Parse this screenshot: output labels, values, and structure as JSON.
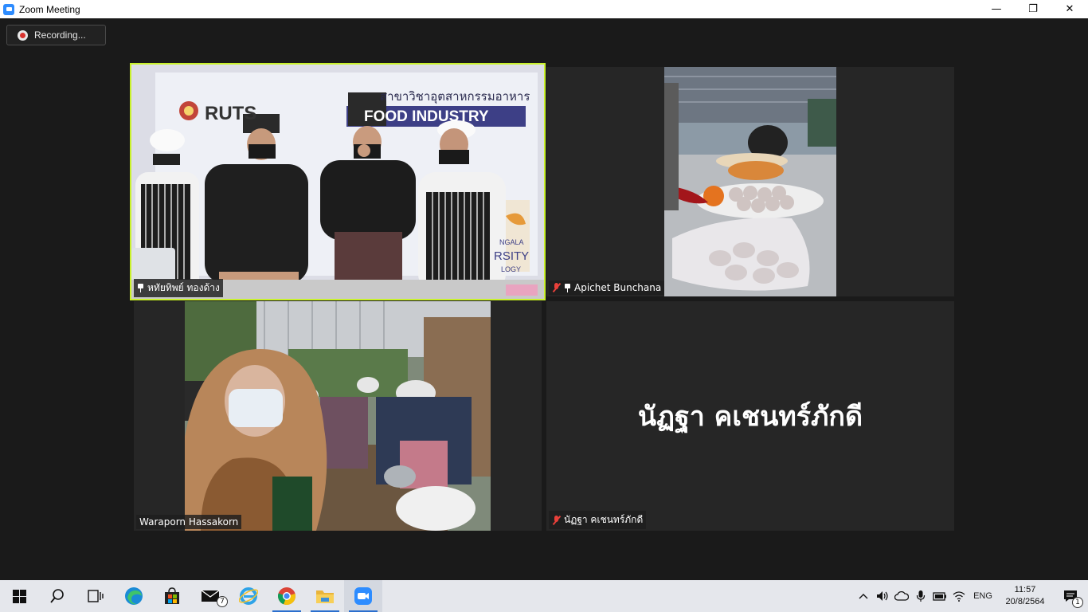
{
  "window": {
    "title": "Zoom Meeting",
    "minimize": "—",
    "restore": "❐",
    "close": "✕"
  },
  "recording": {
    "label": "Recording..."
  },
  "participants": [
    {
      "name": "หทัยทิพย์  ทองด้าง",
      "muted": false,
      "pinned": true,
      "active_speaker": true,
      "video_text": {
        "heading_thai": "สาขาวิชาอุตสาหกรรมอาหาร",
        "banner": "FOOD INDUSTRY",
        "logo": "RUTS",
        "sign1": "NGALA",
        "sign2": "RSITY",
        "sign3": "LOGY"
      }
    },
    {
      "name": "Apichet Bunchana",
      "muted": true,
      "pinned": true,
      "active_speaker": false
    },
    {
      "name": "Waraporn Hassakorn",
      "muted": false,
      "pinned": false,
      "active_speaker": false
    },
    {
      "name": "นัฏฐา คเชนทร์ภักดี",
      "muted": true,
      "pinned": false,
      "active_speaker": false,
      "video_off": true
    }
  ],
  "taskbar": {
    "apps": [
      "start",
      "search",
      "task-view",
      "edge",
      "store",
      "mail",
      "internet-explorer",
      "chrome",
      "file-explorer",
      "zoom"
    ],
    "mail_badge": "7",
    "language": "ENG",
    "time": "11:57",
    "date": "20/8/2564",
    "notification_count": "1"
  },
  "colors": {
    "active_speaker_border": "#c9f12c",
    "meeting_bg": "#1a1a1a",
    "tile_bg": "#262626",
    "mute_red": "#e8403a"
  }
}
